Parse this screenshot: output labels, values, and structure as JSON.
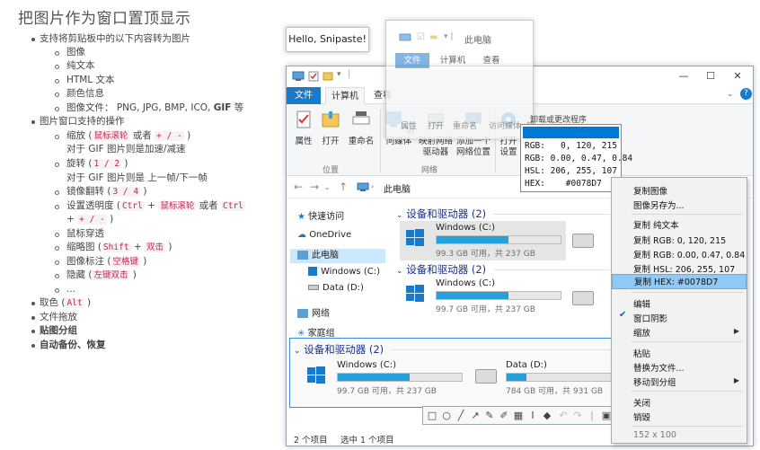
{
  "doc": {
    "title": "把图片作为窗口置顶显示",
    "lines": [
      "支持将剪贴板中的以下内容转为图片",
      "图像",
      "纯文本",
      "HTML 文本",
      "颜色信息",
      "图像文件： PNG, JPG, BMP, ICO, ",
      "GIF",
      " 等",
      "图片窗口支持的操作",
      "缩放 (",
      "鼠标滚轮",
      " 或者 ",
      "+ / -",
      " )",
      "对于 GIF 图片则是加速/减速",
      "旋转 (",
      "1 / 2",
      " )",
      "对于 GIF 图片则是 上一帧/下一帧",
      "镜像翻转 (",
      "3 / 4",
      " )",
      "设置透明度 (",
      "Ctrl",
      " + ",
      "鼠标滚轮",
      " 或者 ",
      "Ctrl",
      " + ",
      "+ / -",
      " )",
      "鼠标穿透",
      "缩略图 (",
      "Shift",
      " + ",
      "双击",
      " )",
      "图像标注 (",
      "空格键",
      " )",
      "隐藏 (",
      "左键双击",
      " )",
      "...",
      "取色 (",
      "Alt",
      " )",
      "文件拖放",
      "贴图分组",
      "自动备份、恢复"
    ]
  },
  "hello_text": "Hello, Snipaste!",
  "ghost": {
    "breadcrumb": "此电脑",
    "tabs": [
      "文件",
      "计算机",
      "查看"
    ],
    "items": [
      "属性",
      "打开",
      "重命名",
      "访问媒体",
      "映"
    ],
    "extra": "卸载或更改程序"
  },
  "window": {
    "tabs": [
      "文件",
      "计算机",
      "查看"
    ],
    "ribbon": {
      "buttons": [
        "属性",
        "打开",
        "重命名",
        "访问媒体",
        "映射网络\n驱动器",
        "添加一个\n网络位置",
        "打开\n设置"
      ],
      "groups": [
        "位置",
        "网络"
      ]
    },
    "address": "此电脑",
    "nav": [
      "快速访问",
      "OneDrive",
      "此电脑",
      "Windows (C:)",
      "Data (D:)",
      "网络",
      "家庭组"
    ],
    "group_header": "设备和驱动器 (2)",
    "drives": [
      {
        "name": "Windows (C:)",
        "size": "99.3 GB 可用，共 237 GB",
        "used": 0.58
      },
      {
        "name": "Windows (C:)",
        "size": "99.7 GB 可用，共 237 GB",
        "used": 0.58
      },
      {
        "name": "Windows (C:)",
        "size": "99.7 GB 可用，共 237 GB",
        "used": 0.58
      },
      {
        "name": "Data (D:)",
        "size": "784 GB 可用，共 931 GB",
        "used": 0.16
      }
    ],
    "status": [
      "2 个项目",
      "选中 1 个项目"
    ],
    "title_controls": [
      "—",
      "☐",
      "✕"
    ]
  },
  "color_card": {
    "swatch": "#0078D7",
    "rgb": "RGB:   0, 120, 215",
    "rgb_float": "RGB: 0.00, 0.47, 0.84",
    "hsl": "HSL: 206, 255, 107",
    "hex": "HEX:    #0078D7"
  },
  "context_menu": {
    "items": [
      "复制图像",
      "图像另存为...",
      "复制 纯文本",
      "复制 RGB: 0, 120, 215",
      "复制 RGB: 0.00, 0.47, 0.84",
      "复制 HSL: 206, 255, 107",
      "复制 HEX: #0078D7",
      "编辑",
      "窗口阴影",
      "缩放",
      "粘贴",
      "替换为文件...",
      "移动到分组",
      "关闭",
      "销毁"
    ],
    "footer": "152 x 100"
  },
  "accent": "#1979ca"
}
